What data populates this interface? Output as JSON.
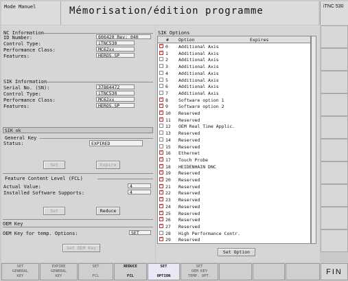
{
  "header": {
    "mode": "Mode Manuel",
    "title": "Mémorisation/édition programme",
    "brand": "iTNC 530"
  },
  "nc_info": {
    "group_title": "NC Information",
    "id_label": "ID Number:",
    "id_value": "606420 Rev: 040",
    "control_label": "Control Type:",
    "control_value": "iTNC530",
    "perf_label": "Performance Class:",
    "perf_value": "MC62xx",
    "features_label": "Features:",
    "features_value": "HEROS,SP"
  },
  "sik_info": {
    "group_title": "SIK Information",
    "serial_label": "Serial No. (SN):",
    "serial_value": "37864472",
    "control_label": "Control Type:",
    "control_value": "iTNC530",
    "perf_label": "Performance Class:",
    "perf_value": "MC62xx",
    "features_label": "Features:",
    "features_value": "HEROS,SP",
    "status_bar": "SIK ok"
  },
  "general_key": {
    "group_title": "General Key",
    "status_label": "Status:",
    "status_value": "EXPIRED",
    "set_button": "Set",
    "expire_button": "Expire"
  },
  "fcl": {
    "group_title": "Feature Content Level (FCL)",
    "actual_label": "Actual Value:",
    "actual_value": "4",
    "installed_label": "Installed Software Supports:",
    "installed_value": "4",
    "set_button": "Set",
    "reduce_button": "Reduce"
  },
  "oem": {
    "group_title": "OEM Key",
    "temp_label": "OEM Key for temp. Options:",
    "temp_value": "SET",
    "set_oem_button": "Set OEM Key"
  },
  "sik_options": {
    "group_title": "SIK Options",
    "col_num": "#",
    "col_option": "Option",
    "col_expires": "Expires",
    "set_option_button": "Set Option",
    "rows": [
      {
        "num": "0",
        "option": "Additional Axis",
        "checked": true
      },
      {
        "num": "1",
        "option": "Additional Axis",
        "checked": true
      },
      {
        "num": "2",
        "option": "Additional Axis",
        "checked": false
      },
      {
        "num": "3",
        "option": "Additional Axis",
        "checked": false
      },
      {
        "num": "4",
        "option": "Additional Axis",
        "checked": false
      },
      {
        "num": "5",
        "option": "Additional Axis",
        "checked": false
      },
      {
        "num": "6",
        "option": "Additional Axis",
        "checked": false
      },
      {
        "num": "7",
        "option": "Additional Axis",
        "checked": false
      },
      {
        "num": "8",
        "option": "Software option 1",
        "checked": true
      },
      {
        "num": "9",
        "option": "Software option 2",
        "checked": true
      },
      {
        "num": "10",
        "option": "Reserved",
        "checked": true
      },
      {
        "num": "11",
        "option": "Reserved",
        "checked": true
      },
      {
        "num": "12",
        "option": "OEM Real Time Applic.",
        "checked": false
      },
      {
        "num": "13",
        "option": "Reserved",
        "checked": false
      },
      {
        "num": "14",
        "option": "Reserved",
        "checked": false
      },
      {
        "num": "15",
        "option": "Reserved",
        "checked": false
      },
      {
        "num": "16",
        "option": "Ethernet",
        "checked": true
      },
      {
        "num": "17",
        "option": "Touch Probe",
        "checked": true
      },
      {
        "num": "18",
        "option": "HEIDENHAIN DNC",
        "checked": true
      },
      {
        "num": "19",
        "option": "Reserved",
        "checked": true
      },
      {
        "num": "20",
        "option": "Reserved",
        "checked": true
      },
      {
        "num": "21",
        "option": "Reserved",
        "checked": true
      },
      {
        "num": "22",
        "option": "Reserved",
        "checked": true
      },
      {
        "num": "23",
        "option": "Reserved",
        "checked": true
      },
      {
        "num": "24",
        "option": "Reserved",
        "checked": true
      },
      {
        "num": "25",
        "option": "Reserved",
        "checked": true
      },
      {
        "num": "26",
        "option": "Reserved",
        "checked": true
      },
      {
        "num": "27",
        "option": "Reserved",
        "checked": true
      },
      {
        "num": "28",
        "option": "High Performance Contr.",
        "checked": false
      },
      {
        "num": "29",
        "option": "Reserved",
        "checked": true
      }
    ]
  },
  "softkeys": [
    {
      "line1": "SET",
      "line2": "GENERAL",
      "line3": "KEY",
      "state": "dim"
    },
    {
      "line1": "EXPIRE",
      "line2": "GENERAL",
      "line3": "KEY",
      "state": "dim"
    },
    {
      "line1": "SET",
      "line2": "",
      "line3": "FCL",
      "state": "dim"
    },
    {
      "line1": "REDUCE",
      "line2": "",
      "line3": "FCL",
      "state": "active"
    },
    {
      "line1": "SET",
      "line2": "",
      "line3": "OPTION",
      "state": "highlight"
    },
    {
      "line1": "SET",
      "line2": "OEM KEY",
      "line3": "TEMP. OPT.",
      "state": "dim"
    },
    {
      "line1": "",
      "line2": "",
      "line3": "",
      "state": "dim"
    },
    {
      "line1": "",
      "line2": "",
      "line3": "",
      "state": "dim"
    }
  ],
  "fin_label": "FIN"
}
